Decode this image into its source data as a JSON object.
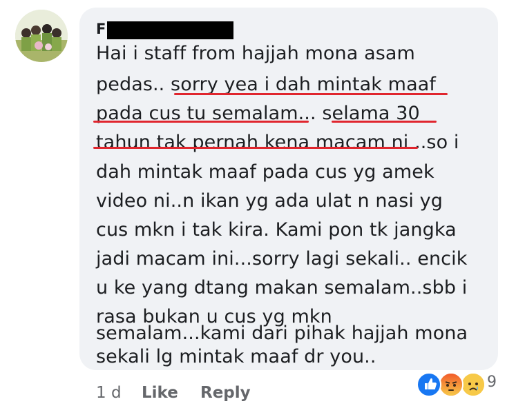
{
  "comment": {
    "author_initial": "F",
    "lines": [
      "Hai i staff from hajjah mona asam",
      "pedas.. sorry yea i dah mintak maaf",
      "pada cus tu semalam... selama 30",
      "tahun tak pernah kena macam ni ..so i",
      "dah mintak maaf pada cus yg amek",
      "video ni..n ikan yg ada ulat n nasi yg",
      "cus mkn i tak kira. Kami pon tk jangka",
      "jadi macam ini...sorry lagi sekali.. encik",
      "u ke yang dtang makan semalam..sbb i",
      "rasa bukan u cus yg mkn",
      "semalam...kami dari pihak hajjah mona",
      "sekali lg mintak maaf dr you.."
    ]
  },
  "actions": {
    "time": "1 d",
    "like": "Like",
    "reply": "Reply"
  },
  "reactions": {
    "icons": [
      "like-icon",
      "angry-icon",
      "sad-icon"
    ],
    "count": "9"
  },
  "colors": {
    "bubble": "#f0f2f5",
    "underline": "#e0262e",
    "like_blue": "#1877f2",
    "angry_orange": "#f25c2b",
    "sad_yellow": "#f7c948"
  }
}
